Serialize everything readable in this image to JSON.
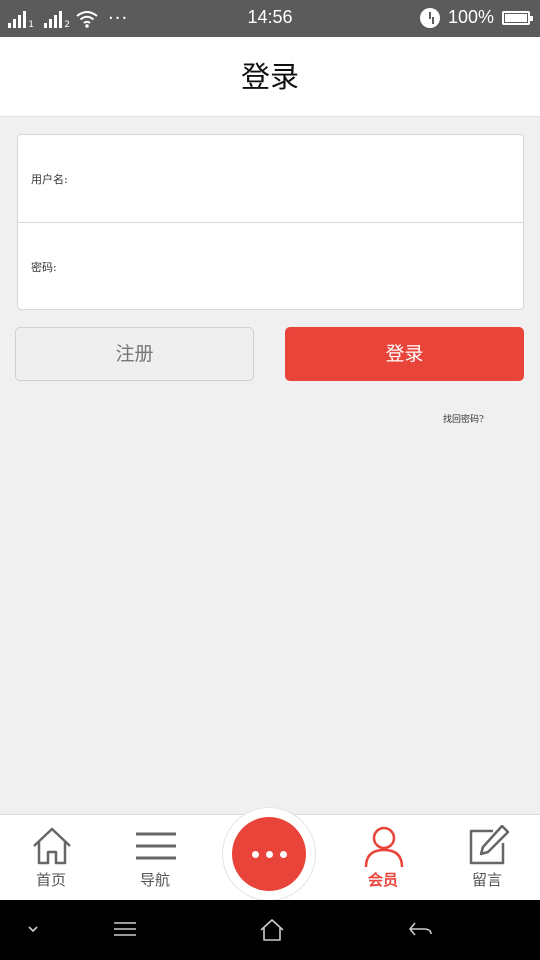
{
  "status_bar": {
    "sim1": "1",
    "sim2": "2",
    "time": "14:56",
    "battery": "100%",
    "more_dots": "···"
  },
  "header": {
    "title": "登录"
  },
  "form": {
    "username_label": "用户名:",
    "username_value": "",
    "password_label": "密码:",
    "password_value": ""
  },
  "buttons": {
    "register": "注册",
    "login": "登录"
  },
  "forgot_password": "找回密码?",
  "bottom_nav": {
    "items": [
      {
        "label": "首页",
        "icon": "home-icon"
      },
      {
        "label": "导航",
        "icon": "menu-icon"
      },
      {
        "label": "",
        "icon": "more-icon"
      },
      {
        "label": "会员",
        "icon": "user-icon",
        "active": true
      },
      {
        "label": "留言",
        "icon": "edit-icon"
      }
    ]
  },
  "colors": {
    "accent": "#e8443a",
    "status_bar": "#5b5b5b",
    "background": "#f0f0f0"
  }
}
